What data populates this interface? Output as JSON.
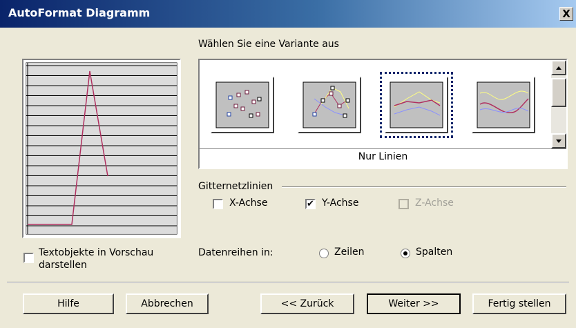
{
  "title": "AutoFormat Diagramm",
  "close_label": "X",
  "variant_prompt": "Wählen Sie eine Variante aus",
  "variants": [
    {
      "name": "points-only-icon"
    },
    {
      "name": "points-and-lines-icon"
    },
    {
      "name": "lines-only-icon"
    },
    {
      "name": "smooth-lines-icon"
    }
  ],
  "selected_variant_label": "Nur Linien",
  "gridlines": {
    "label": "Gitternetzlinien",
    "x_axis": {
      "label": "X-Achse",
      "checked": false
    },
    "y_axis": {
      "label": "Y-Achse",
      "checked": true
    },
    "z_axis": {
      "label": "Z-Achse",
      "checked": false,
      "disabled": true
    }
  },
  "text_objects": {
    "label_line1": "Textobjekte in Vorschau",
    "label_line2": "darstellen",
    "checked": false
  },
  "data_series": {
    "label": "Datenreihen in:",
    "rows": "Zeilen",
    "columns": "Spalten",
    "selected": "Spalten"
  },
  "buttons": {
    "help": "Hilfe",
    "cancel": "Abbrechen",
    "back": "<< Zurück",
    "next": "Weiter >>",
    "finish": "Fertig stellen"
  },
  "colors": {
    "title_start": "#0a246a",
    "line_series": "#b03060",
    "gallery_bg": "#ffffff"
  }
}
